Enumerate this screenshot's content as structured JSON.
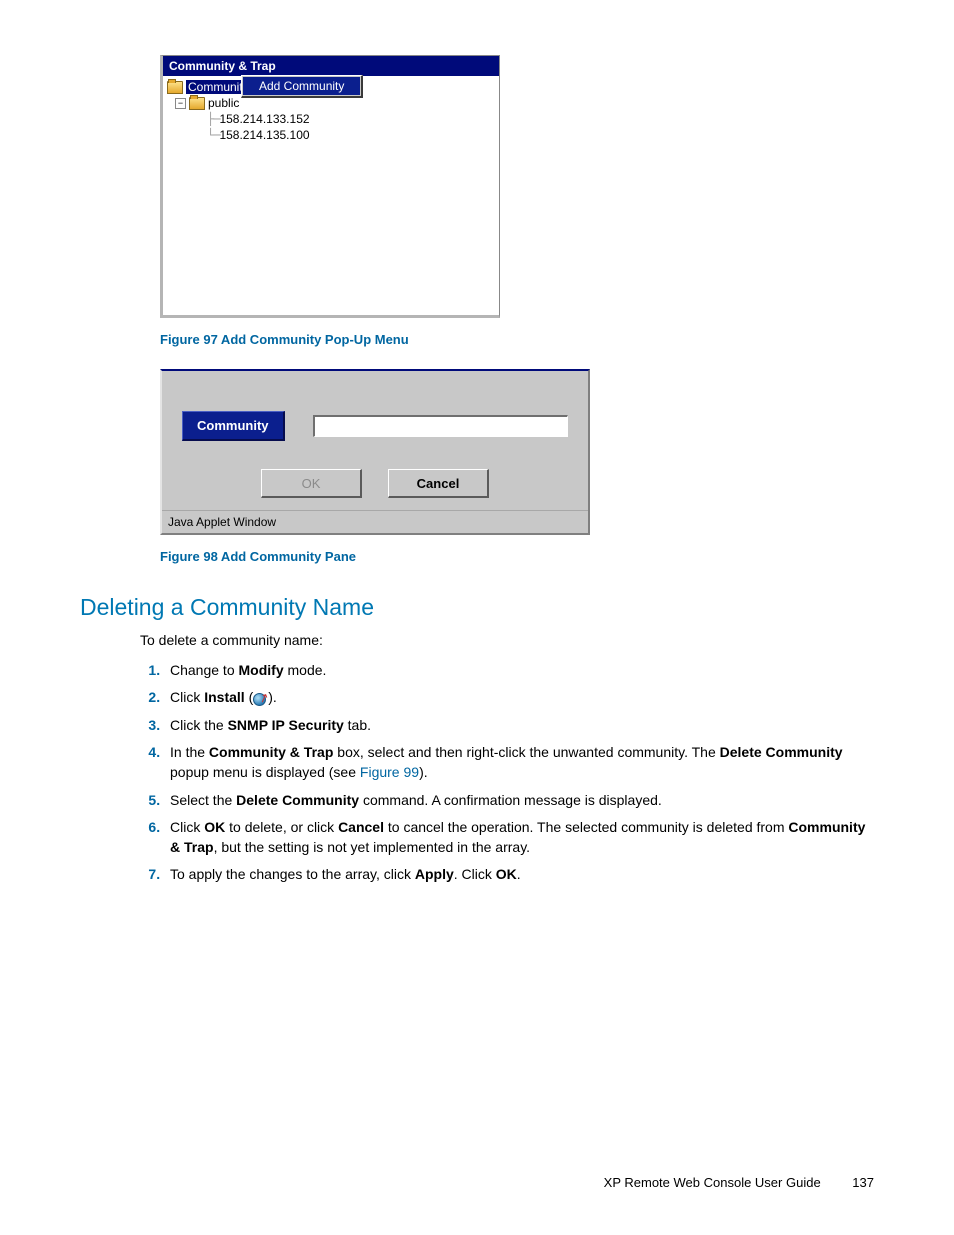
{
  "fig97": {
    "titlebar": "Community & Trap",
    "root": "Community",
    "node_public": "public",
    "ip1": "158.214.133.152",
    "ip2": "158.214.135.100",
    "popup_item": "Add Community",
    "caption": "Figure 97 Add Community Pop-Up Menu"
  },
  "fig98": {
    "label": "Community",
    "ok": "OK",
    "cancel": "Cancel",
    "status": "Java Applet Window",
    "caption": "Figure 98 Add Community Pane"
  },
  "section_heading": "Deleting a Community Name",
  "intro": "To delete a community name:",
  "steps": {
    "s1_a": "Change to ",
    "s1_b": "Modify",
    "s1_c": " mode.",
    "s2_a": "Click ",
    "s2_b": "Install",
    "s2_c": " (",
    "s2_d": ").",
    "s3_a": "Click the ",
    "s3_b": "SNMP IP Security",
    "s3_c": " tab.",
    "s4_a": "In the ",
    "s4_b": "Community & Trap",
    "s4_c": " box, select and then right-click the unwanted community. The ",
    "s4_d": "Delete Community",
    "s4_e": " popup menu is displayed (see ",
    "s4_link": "Figure 99",
    "s4_f": ").",
    "s5_a": "Select the ",
    "s5_b": "Delete Community",
    "s5_c": " command. A confirmation message is displayed.",
    "s6_a": "Click ",
    "s6_b": "OK",
    "s6_c": " to delete, or click ",
    "s6_d": "Cancel",
    "s6_e": " to cancel the operation. The selected community is deleted from ",
    "s6_f": "Community & Trap",
    "s6_g": ", but the setting is not yet implemented in the array.",
    "s7_a": "To apply the changes to the array, click ",
    "s7_b": "Apply",
    "s7_c": ". Click ",
    "s7_d": "OK",
    "s7_e": "."
  },
  "footer_text": "XP Remote Web Console User Guide",
  "page_number": "137"
}
